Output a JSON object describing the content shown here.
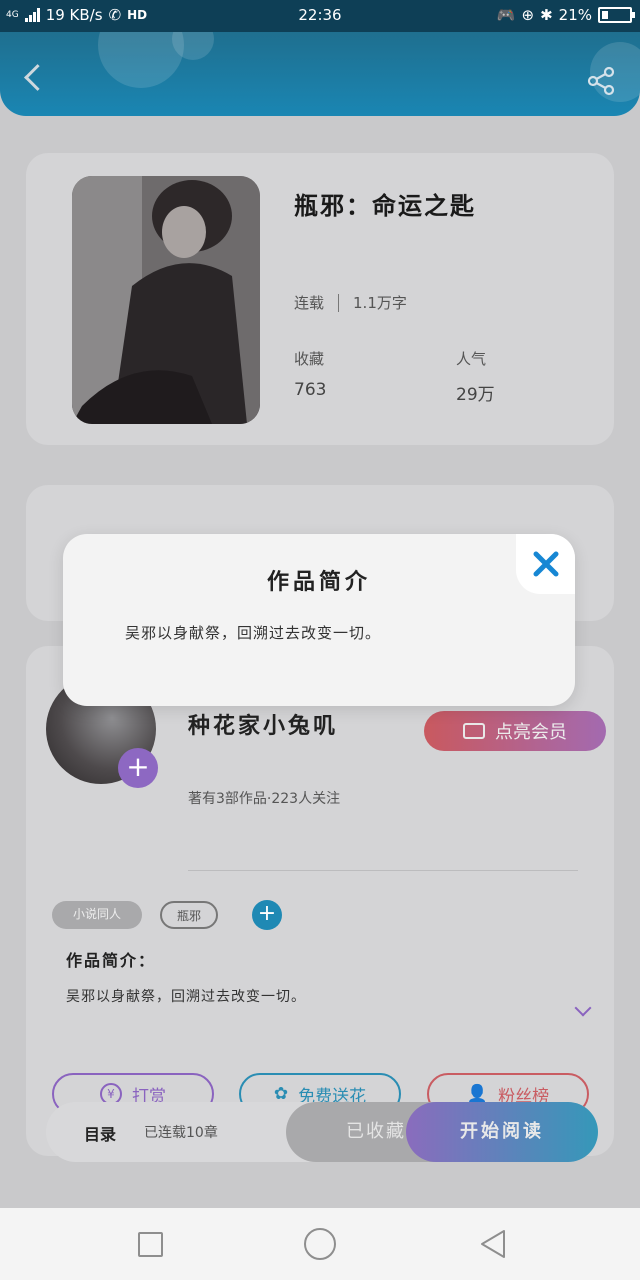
{
  "status_bar": {
    "network": "4G",
    "speed": "19 KB/s",
    "hd": "HD",
    "time": "22:36",
    "battery": "21%"
  },
  "book": {
    "title": "瓶邪：命运之匙",
    "status": "连载",
    "word_count": "1.1万字",
    "collect_label": "收藏",
    "collect_value": "763",
    "popularity_label": "人气",
    "popularity_value": "29万"
  },
  "author": {
    "name": "种花家小兔叽",
    "meta": "著有3部作品·223人关注",
    "vip_label": "点亮会员"
  },
  "tags": [
    "小说同人",
    "瓶邪"
  ],
  "intro": {
    "heading": "作品简介：",
    "text": "吴邪以身献祭，回溯过去改变一切。"
  },
  "actions": {
    "tip": "打赏",
    "flowers": "免费送花",
    "fans": "粉丝榜"
  },
  "bottom_bar": {
    "toc": "目录",
    "toc_status": "已连载10章",
    "collected": "已收藏",
    "start_reading": "开始阅读"
  },
  "modal": {
    "title": "作品简介",
    "text": "吴邪以身献祭，回溯过去改变一切。"
  },
  "colors": {
    "header": "#1a86b3",
    "accent_purple": "#8d68c2",
    "accent_blue": "#1f89b4",
    "vip_red": "#c9595f"
  }
}
